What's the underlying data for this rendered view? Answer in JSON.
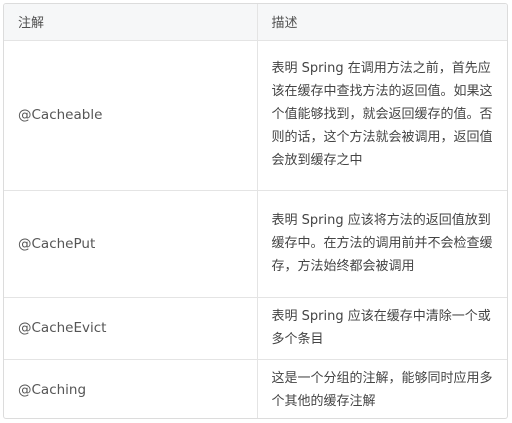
{
  "headers": {
    "annotation": "注解",
    "description": "描述"
  },
  "rows": [
    {
      "name": "@Cacheable",
      "description": "表明 Spring 在调用方法之前，首先应该在缓存中查找方法的返回值。如果这个值能够找到，就会返回缓存的值。否则的话，这个方法就会被调用，返回值会放到缓存之中"
    },
    {
      "name": "@CachePut",
      "description": "表明 Spring 应该将方法的返回值放到缓存中。在方法的调用前并不会检查缓存，方法始终都会被调用"
    },
    {
      "name": "@CacheEvict",
      "description": "表明 Spring 应该在缓存中清除一个或多个条目"
    },
    {
      "name": "@Caching",
      "description": "这是一个分组的注解，能够同时应用多个其他的缓存注解"
    }
  ]
}
